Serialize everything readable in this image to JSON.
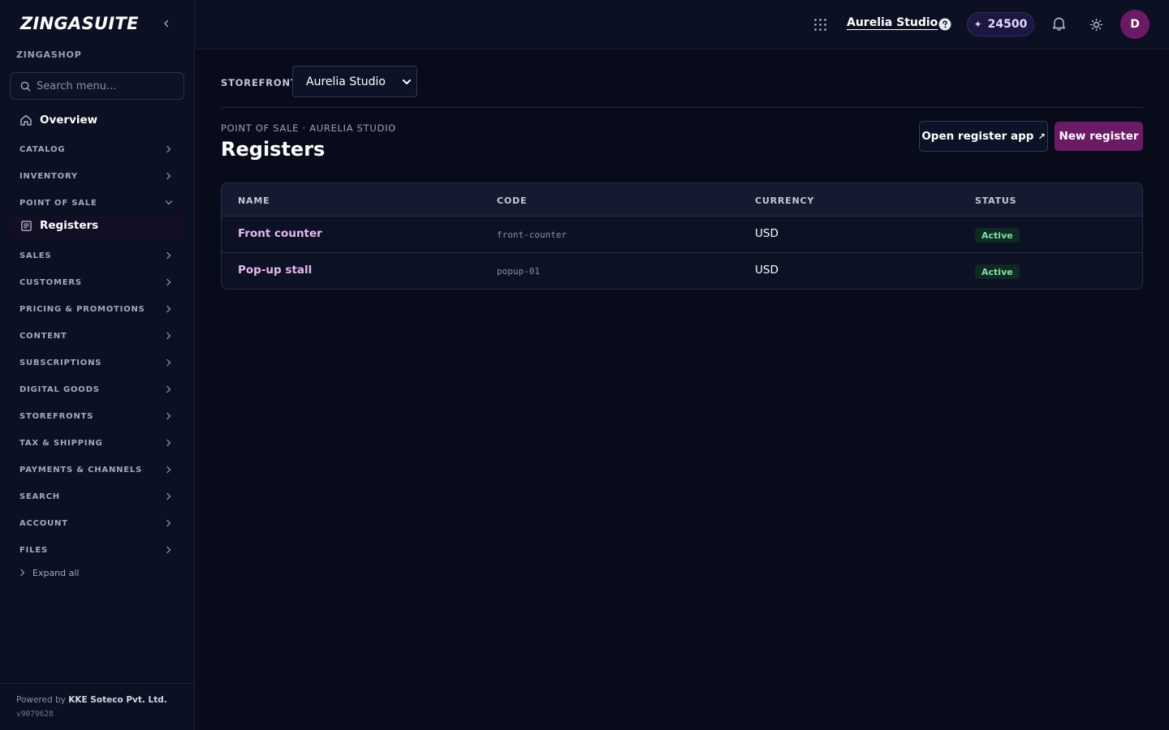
{
  "app": {
    "brand": "ZINGASUITE",
    "org": "ZINGASHOP"
  },
  "sidebar": {
    "search_placeholder": "Search menu...",
    "overview_label": "Overview",
    "sections": [
      {
        "label": "CATALOG",
        "expanded": false
      },
      {
        "label": "INVENTORY",
        "expanded": false
      },
      {
        "label": "POINT OF SALE",
        "expanded": true
      },
      {
        "label": "SALES",
        "expanded": false
      },
      {
        "label": "CUSTOMERS",
        "expanded": false
      },
      {
        "label": "PRICING & PROMOTIONS",
        "expanded": false
      },
      {
        "label": "CONTENT",
        "expanded": false
      },
      {
        "label": "SUBSCRIPTIONS",
        "expanded": false
      },
      {
        "label": "DIGITAL GOODS",
        "expanded": false
      },
      {
        "label": "STOREFRONTS",
        "expanded": false
      },
      {
        "label": "TAX & SHIPPING",
        "expanded": false
      },
      {
        "label": "PAYMENTS & CHANNELS",
        "expanded": false
      },
      {
        "label": "SEARCH",
        "expanded": false
      },
      {
        "label": "ACCOUNT",
        "expanded": false
      },
      {
        "label": "FILES",
        "expanded": false
      }
    ],
    "active_item": "Registers",
    "expand_all_label": "Expand all",
    "footer": {
      "powered_prefix": "Powered by",
      "powered_company": "KKE Soteco Pvt. Ltd.",
      "version": "v9079628"
    }
  },
  "topbar": {
    "studio_name": "Aurelia Studio",
    "credits": "24500",
    "avatar_initial": "D"
  },
  "main": {
    "storefront_label": "STOREFRONT",
    "storefront_value": "Aurelia Studio",
    "breadcrumb": "POINT OF SALE · AURELIA STUDIO",
    "title": "Registers",
    "open_register_label": "Open register app",
    "new_register_label": "New register",
    "table": {
      "columns": [
        "NAME",
        "CODE",
        "CURRENCY",
        "STATUS"
      ],
      "rows": [
        {
          "name": "Front counter",
          "code": "front-counter",
          "currency": "USD",
          "status": "Active"
        },
        {
          "name": "Pop-up stall",
          "code": "popup-01",
          "currency": "USD",
          "status": "Active"
        }
      ]
    }
  },
  "colors": {
    "background": "#070b1a",
    "sidebar": "#0b1022",
    "accent": "#6b1a66",
    "link": "#e7b6f0",
    "status_active": "#7ee0a4"
  }
}
